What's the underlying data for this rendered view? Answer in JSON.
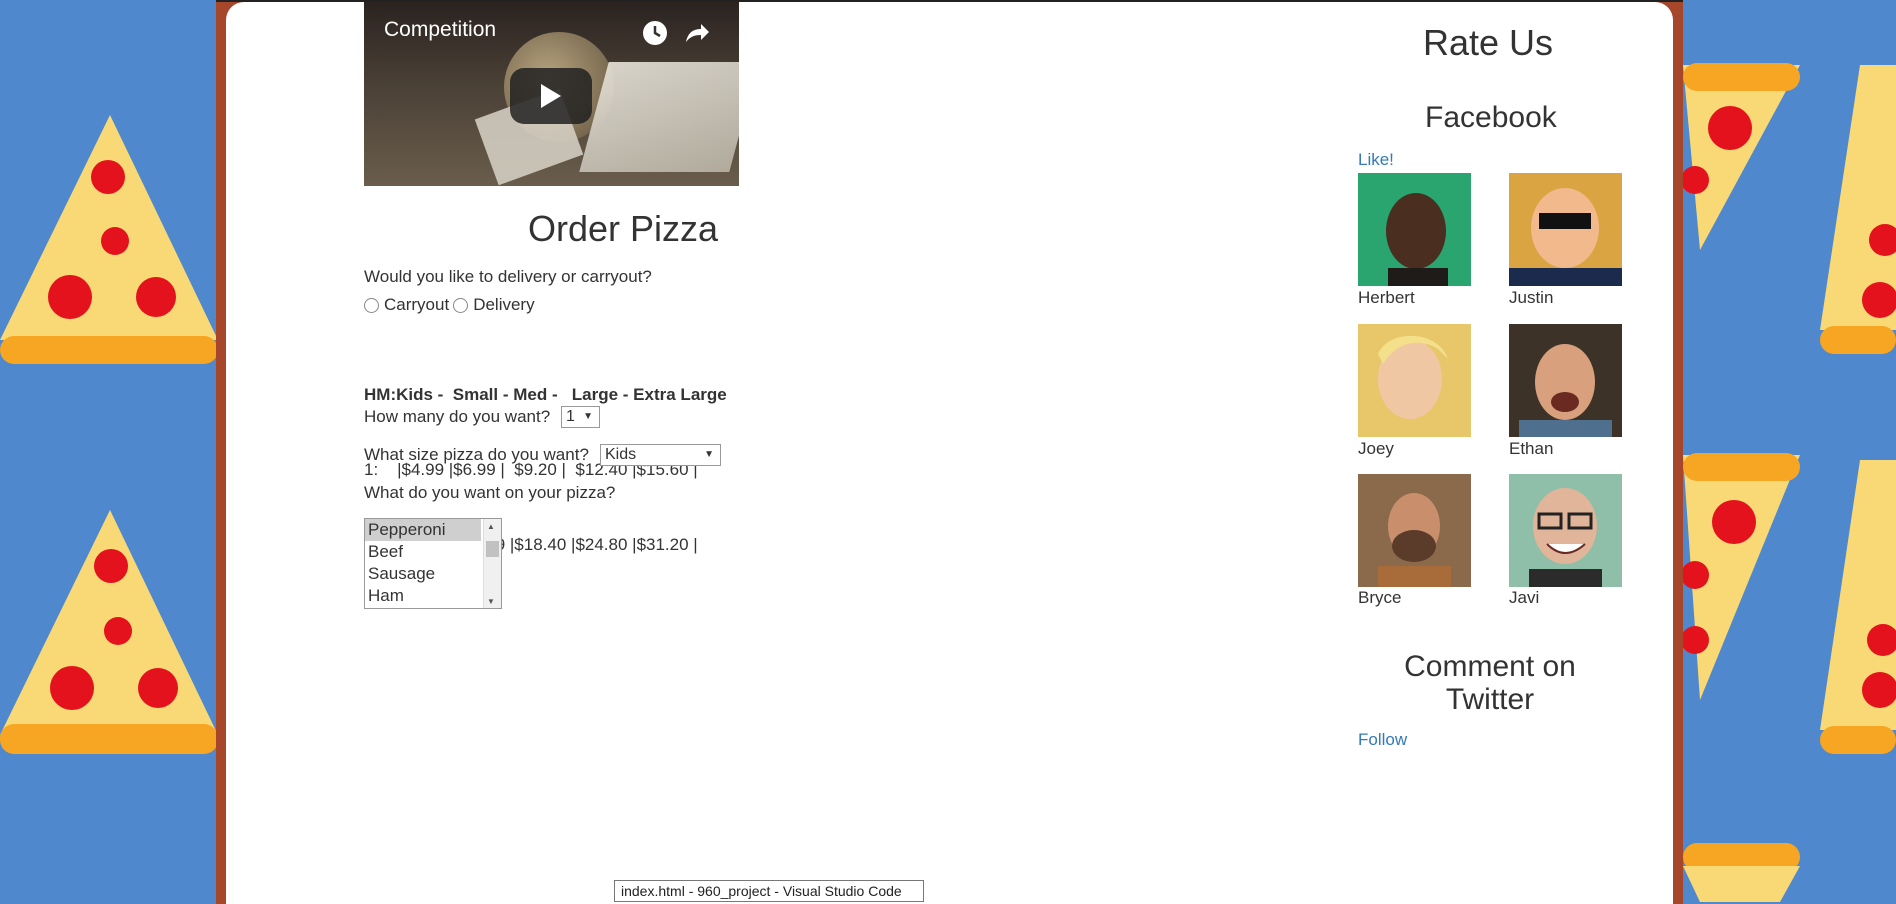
{
  "video": {
    "title": "Competition",
    "icons": [
      "clock-icon",
      "share-icon",
      "play-icon"
    ]
  },
  "order": {
    "title": "Order Pizza",
    "delivery_question": "Would you like to delivery or carryout?",
    "options": [
      {
        "label": "Carryout"
      },
      {
        "label": "Delivery"
      }
    ],
    "price_header": "HM:Kids -  Small - Med -   Large - Extra Large",
    "price_rows": [
      "1:    |$4.99 |$6.99 |  $9.20 |  $12.40 |$15.60 |",
      "2:    |$9.99 |$12.99 |$18.40 |$24.80 |$31.20 |"
    ],
    "quantity_question": "How many do you want?",
    "quantity_value": "1",
    "size_question": "What size pizza do you want?",
    "size_value": "Kids",
    "toppings_question": "What do you want on your pizza?",
    "toppings": [
      "Pepperoni",
      "Beef",
      "Sausage",
      "Ham"
    ]
  },
  "rate": {
    "title": "Rate Us",
    "facebook_title": "Facebook",
    "like_label": "Like!",
    "people": [
      {
        "name": "Herbert",
        "color": "#2aa56f"
      },
      {
        "name": "Justin",
        "color": "#d9a441"
      },
      {
        "name": "Joey",
        "color": "#e7c76a"
      },
      {
        "name": "Ethan",
        "color": "#3d3228"
      },
      {
        "name": "Bryce",
        "color": "#8a6a4a"
      },
      {
        "name": "Javi",
        "color": "#8fbfa8"
      }
    ],
    "twitter_title": "Comment on Twitter",
    "follow_label": "Follow"
  },
  "taskbar": {
    "tooltip": "index.html - 960_project - Visual Studio Code"
  },
  "colors": {
    "background_blue": "#4f88cd",
    "frame_brown": "#a6472c",
    "link_blue": "#337ab7"
  }
}
